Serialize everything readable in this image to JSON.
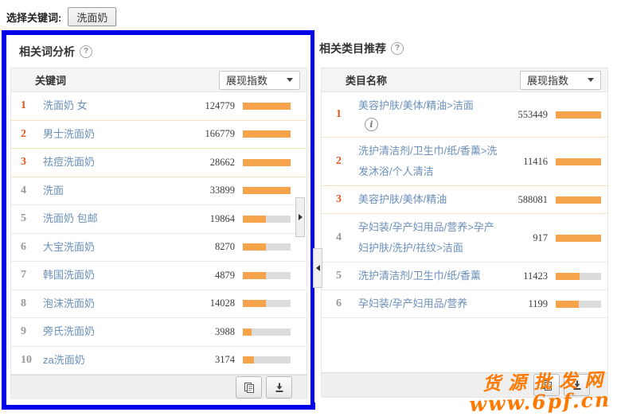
{
  "topbar": {
    "label": "选择关键词:",
    "selected_keyword": "洗面奶"
  },
  "icons": {
    "help": "?",
    "info": "i",
    "copy": "copy-pages-glyph",
    "download": "down-arrow-to-tray-glyph",
    "collapse_right": "right-triangle",
    "collapse_left": "left-triangle"
  },
  "left_panel": {
    "title": "相关词分析",
    "table": {
      "column_header": "关键词",
      "sort_selected": "展现指数",
      "rows": [
        {
          "rank": "1",
          "label": "洗面奶 女",
          "value": "124779",
          "bar_pct": 100
        },
        {
          "rank": "2",
          "label": "男士洗面奶",
          "value": "166779",
          "bar_pct": 100
        },
        {
          "rank": "3",
          "label": "祛痘洗面奶",
          "value": "28662",
          "bar_pct": 100
        },
        {
          "rank": "4",
          "label": "洗面",
          "value": "33899",
          "bar_pct": 100
        },
        {
          "rank": "5",
          "label": "洗面奶 包邮",
          "value": "19864",
          "bar_pct": 48
        },
        {
          "rank": "6",
          "label": "大宝洗面奶",
          "value": "8270",
          "bar_pct": 48
        },
        {
          "rank": "7",
          "label": "韩国洗面奶",
          "value": "4879",
          "bar_pct": 48
        },
        {
          "rank": "8",
          "label": "泡沫洗面奶",
          "value": "14028",
          "bar_pct": 48
        },
        {
          "rank": "9",
          "label": "旁氏洗面奶",
          "value": "3988",
          "bar_pct": 19
        },
        {
          "rank": "10",
          "label": "za洗面奶",
          "value": "3174",
          "bar_pct": 23
        }
      ]
    }
  },
  "right_panel": {
    "title": "相关类目推荐",
    "table": {
      "column_header": "类目名称",
      "sort_selected": "展现指数",
      "rows": [
        {
          "rank": "1",
          "label": "美容护肤/美体/精油>洁面",
          "value": "553449",
          "bar_pct": 100,
          "has_info": true
        },
        {
          "rank": "2",
          "label": "洗护清洁剂/卫生巾/纸/香薰>洗发沐浴/个人清洁",
          "value": "11416",
          "bar_pct": 100
        },
        {
          "rank": "3",
          "label": "美容护肤/美体/精油",
          "value": "588081",
          "bar_pct": 100
        },
        {
          "rank": "4",
          "label": "孕妇装/孕产妇用品/营养>孕产妇护肤/洗护/祛纹>洁面",
          "value": "917",
          "bar_pct": 100
        },
        {
          "rank": "5",
          "label": "洗护清洁剂/卫生巾/纸/香薰",
          "value": "11423",
          "bar_pct": 52
        },
        {
          "rank": "6",
          "label": "孕妇装/孕产妇用品/营养",
          "value": "1199",
          "bar_pct": 50
        }
      ]
    }
  },
  "watermark": {
    "line1": "货源批发网",
    "line2": "www.6pf.cn"
  },
  "colors": {
    "highlight_border": "#0000e8",
    "bar_fill": "#f6a44c",
    "bar_track": "#dcdcdc",
    "rank_top3": "#e4571c",
    "link": "#6a8fb9",
    "watermark": "#ff7900"
  }
}
